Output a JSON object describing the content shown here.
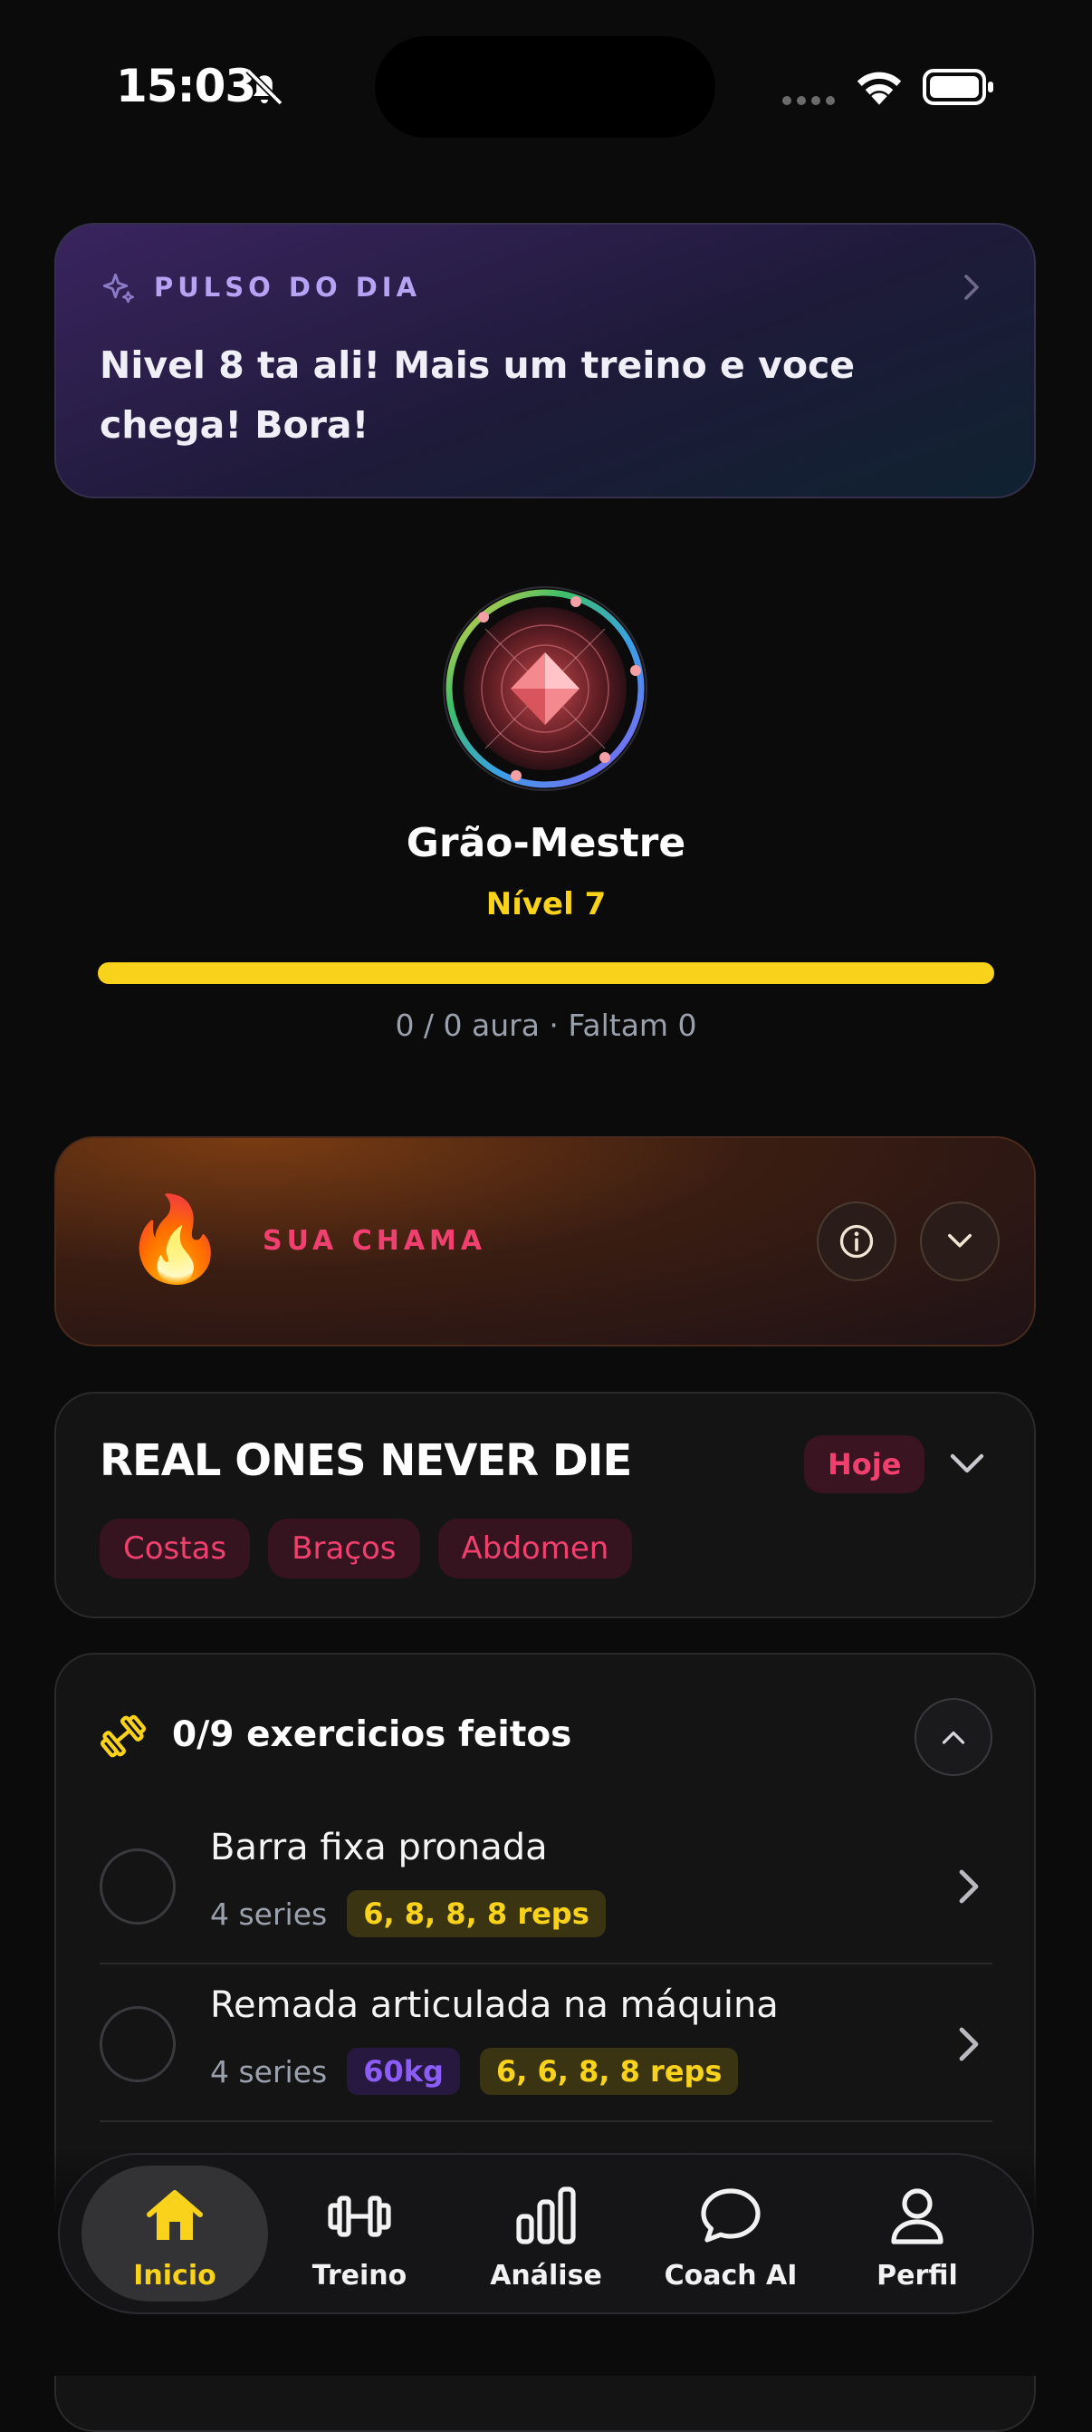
{
  "status_bar": {
    "time": "15:03"
  },
  "pulse": {
    "title": "PULSO DO DIA",
    "message": "Nivel 8 ta ali! Mais um treino e voce chega! Bora!"
  },
  "level": {
    "name": "Grão-Mestre",
    "level_label": "Nível 7",
    "progress": 1.0,
    "aura_text": "0 / 0 aura · Faltam 0"
  },
  "flame": {
    "title": "SUA CHAMA",
    "emoji": "🔥"
  },
  "workout": {
    "title": "REAL ONES NEVER DIE",
    "badge": "Hoje",
    "tags": [
      "Costas",
      "Braços",
      "Abdomen"
    ]
  },
  "exercises": {
    "count_label": "0/9 exercicios feitos",
    "items": [
      {
        "name": "Barra fixa pronada",
        "series": "4 series",
        "weight": "",
        "reps": "6, 8, 8, 8 reps"
      },
      {
        "name": "Remada articulada na máquina",
        "series": "4 series",
        "weight": "60kg",
        "reps": "6, 6, 8, 8 reps"
      }
    ]
  },
  "nav": {
    "items": [
      {
        "label": "Inicio",
        "icon": "home-icon",
        "active": true
      },
      {
        "label": "Treino",
        "icon": "dumbbell-icon",
        "active": false
      },
      {
        "label": "Análise",
        "icon": "bar-chart-icon",
        "active": false
      },
      {
        "label": "Coach AI",
        "icon": "chat-bubble-icon",
        "active": false
      },
      {
        "label": "Perfil",
        "icon": "user-icon",
        "active": false
      }
    ]
  },
  "colors": {
    "accent_yellow": "#f8d21b",
    "accent_pink": "#f0406f",
    "accent_purple": "#8b5cf6",
    "background": "#0b0b0c"
  }
}
